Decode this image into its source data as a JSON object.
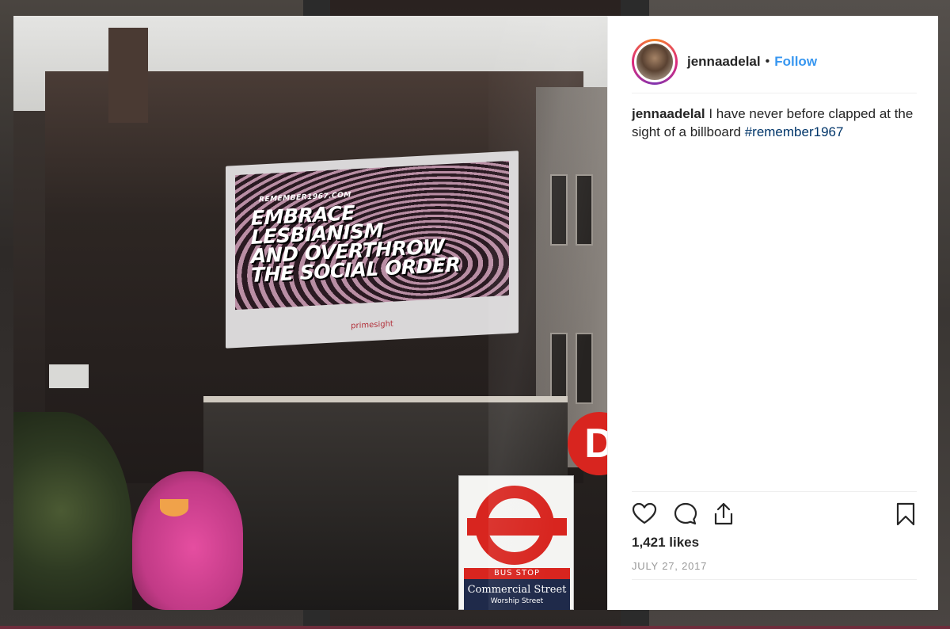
{
  "post": {
    "username": "jennaadelal",
    "follow_label": "Follow",
    "separator": "•",
    "caption_user": "jennaadelal",
    "caption_text": " I have never before clapped at the sight of a billboard ",
    "caption_hashtag": "#remember1967",
    "likes": "1,421 likes",
    "date": "JULY 27, 2017"
  },
  "photo": {
    "billboard_url": "REMEMBER1967.COM",
    "billboard_headline": "EMBRACE\nLESBIANISM\nAND OVERTHROW\nTHE SOCIAL ORDER",
    "billboard_brand": "primesight",
    "bus_stop_label": "BUS STOP",
    "bus_street": "Commercial Street",
    "bus_sub": "Worship Street",
    "d_sign": "D"
  },
  "icons": {
    "like": "heart-icon",
    "comment": "comment-icon",
    "share": "share-icon",
    "save": "bookmark-icon"
  },
  "colors": {
    "follow": "#3897f0",
    "hashtag": "#003569",
    "text": "#262626",
    "muted": "#999999"
  }
}
